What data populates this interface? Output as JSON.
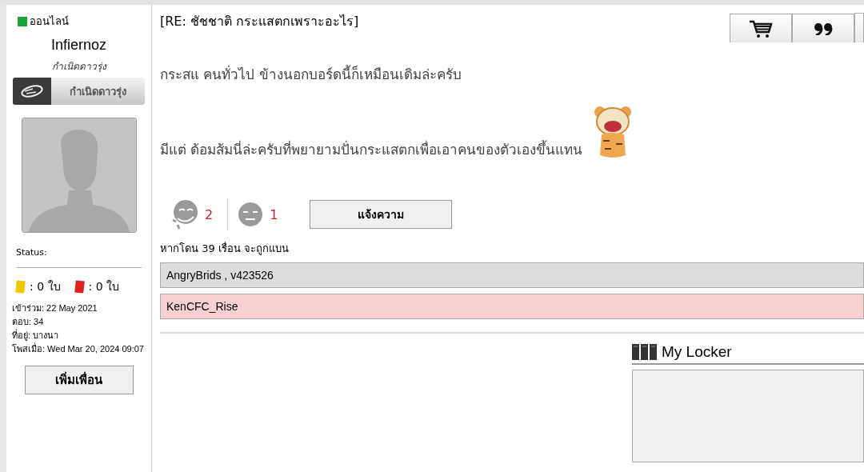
{
  "profile": {
    "online_status": "ออนไลน์",
    "online": true,
    "username": "Infiernoz",
    "rank_title": "กำเนิดดาวรุ่ง",
    "rank_badge": "กำเนิดดาวรุ่ง",
    "status_label": "Status:",
    "yellow_cards": ": 0 ใบ",
    "red_cards": ": 0 ใบ",
    "details": [
      "เข้าร่วม: 22 May 2021",
      "ตอบ: 34",
      "ที่อยู่: บางนา",
      "โพสเมื่อ: Wed Mar 20, 2024 09:07"
    ],
    "add_friend_button": "เพิ่มเพื่อน"
  },
  "post": {
    "title": "[RE: ชัชชาติ กระแสตกเพราะอะไร]",
    "toolbar": [
      {
        "kind": "cart"
      },
      {
        "kind": "quote"
      }
    ],
    "paragraphs": [
      "กระสแ คนทั่วไป ข้างนอกบอร์ดนี้ก็เหมือนเดิมล่ะครับ",
      "มีแต่ ด้อมส้มนี่ล่ะครับที่พยายามปั่นกระแสตกเพื่อเอาคนของตัวเองขึ้นแทน"
    ],
    "reactions": [
      {
        "kind": "laugh",
        "count": "2"
      },
      {
        "kind": "meh",
        "count": "1"
      }
    ],
    "report_button": "แจ้งความ",
    "ban_note": "หากโดน 39 เรื่อน จะถูกแบน",
    "voter_rows": [
      {
        "text": "AngryBrids , v423526",
        "color": "#dcdcdc"
      },
      {
        "text": "KenCFC_Rise",
        "color": "#f8d0d2"
      }
    ]
  },
  "locker": {
    "title": "My Locker"
  }
}
